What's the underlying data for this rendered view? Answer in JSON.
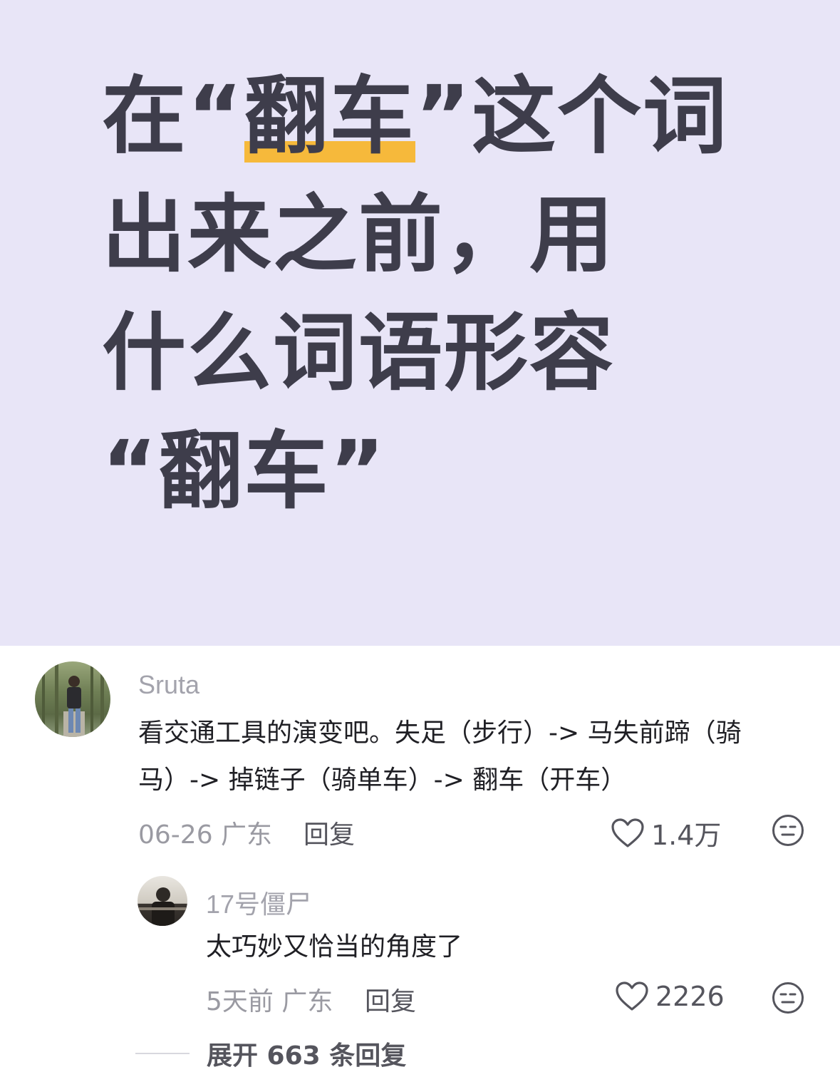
{
  "banner": {
    "line1_pre": "在“",
    "line1_highlight": "翻车",
    "line1_post": "”这个词",
    "line2": "出来之前，用",
    "line3": "什么词语形容",
    "line4": "“翻车”",
    "highlight_color": "#f6b93b",
    "background_color": "#e8e5f7"
  },
  "comment": {
    "username": "Sruta",
    "text_line1": "看交通工具的演变吧。失足（步行）-> 马失前蹄（骑",
    "text_line2": "马）-> 掉链子（骑单车）-> 翻车（开车）",
    "meta": "06-26 广东",
    "reply_label": "回复",
    "like_count": "1.4万"
  },
  "reply": {
    "username": "17号僵尸",
    "text": "太巧妙又恰当的角度了",
    "meta": "5天前 广东",
    "reply_label": "回复",
    "like_count": "2226"
  },
  "expand": {
    "label": "展开 663 条回复"
  }
}
